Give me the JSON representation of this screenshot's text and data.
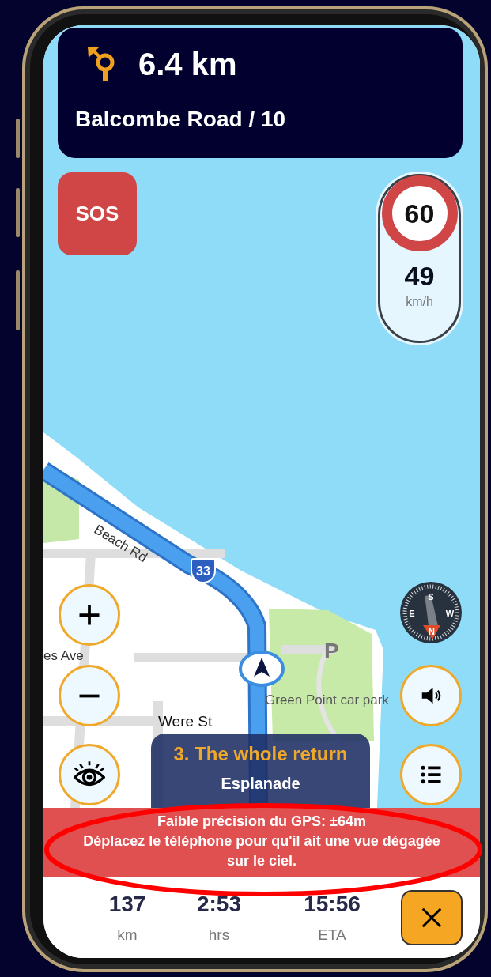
{
  "navigation": {
    "distance": "6.4 km",
    "street": "Balcombe Road / 10"
  },
  "sos_button": {
    "label": "SOS"
  },
  "speed": {
    "limit": "60",
    "current": "49",
    "unit": "km/h"
  },
  "map": {
    "route_shield": "33",
    "labels": [
      {
        "kind": "road",
        "text": "Beach Rd"
      },
      {
        "kind": "street",
        "text": "es Ave"
      },
      {
        "kind": "parking",
        "text": "P"
      },
      {
        "kind": "poi",
        "text": "Green Point car park"
      },
      {
        "kind": "street2",
        "text": "Were St"
      }
    ]
  },
  "compass": {
    "north": "N",
    "south": "S",
    "east": "E",
    "west": "W"
  },
  "left_controls": [
    {
      "kind": "zoom-in"
    },
    {
      "kind": "zoom-out"
    },
    {
      "kind": "view"
    }
  ],
  "right_controls": [
    {
      "kind": "compass"
    },
    {
      "kind": "sound"
    },
    {
      "kind": "list"
    }
  ],
  "instruction": {
    "title": "3. The whole return",
    "street": "Esplanade"
  },
  "warning": {
    "title": "Faible précision du GPS: ±64m",
    "message": "Déplacez le téléphone pour qu'il ait une vue dégagée sur le ciel."
  },
  "trip_stats": [
    {
      "value": "137",
      "unit": "km"
    },
    {
      "value": "2:53",
      "unit": "hrs"
    },
    {
      "value": "15:56",
      "unit": "ETA"
    }
  ]
}
